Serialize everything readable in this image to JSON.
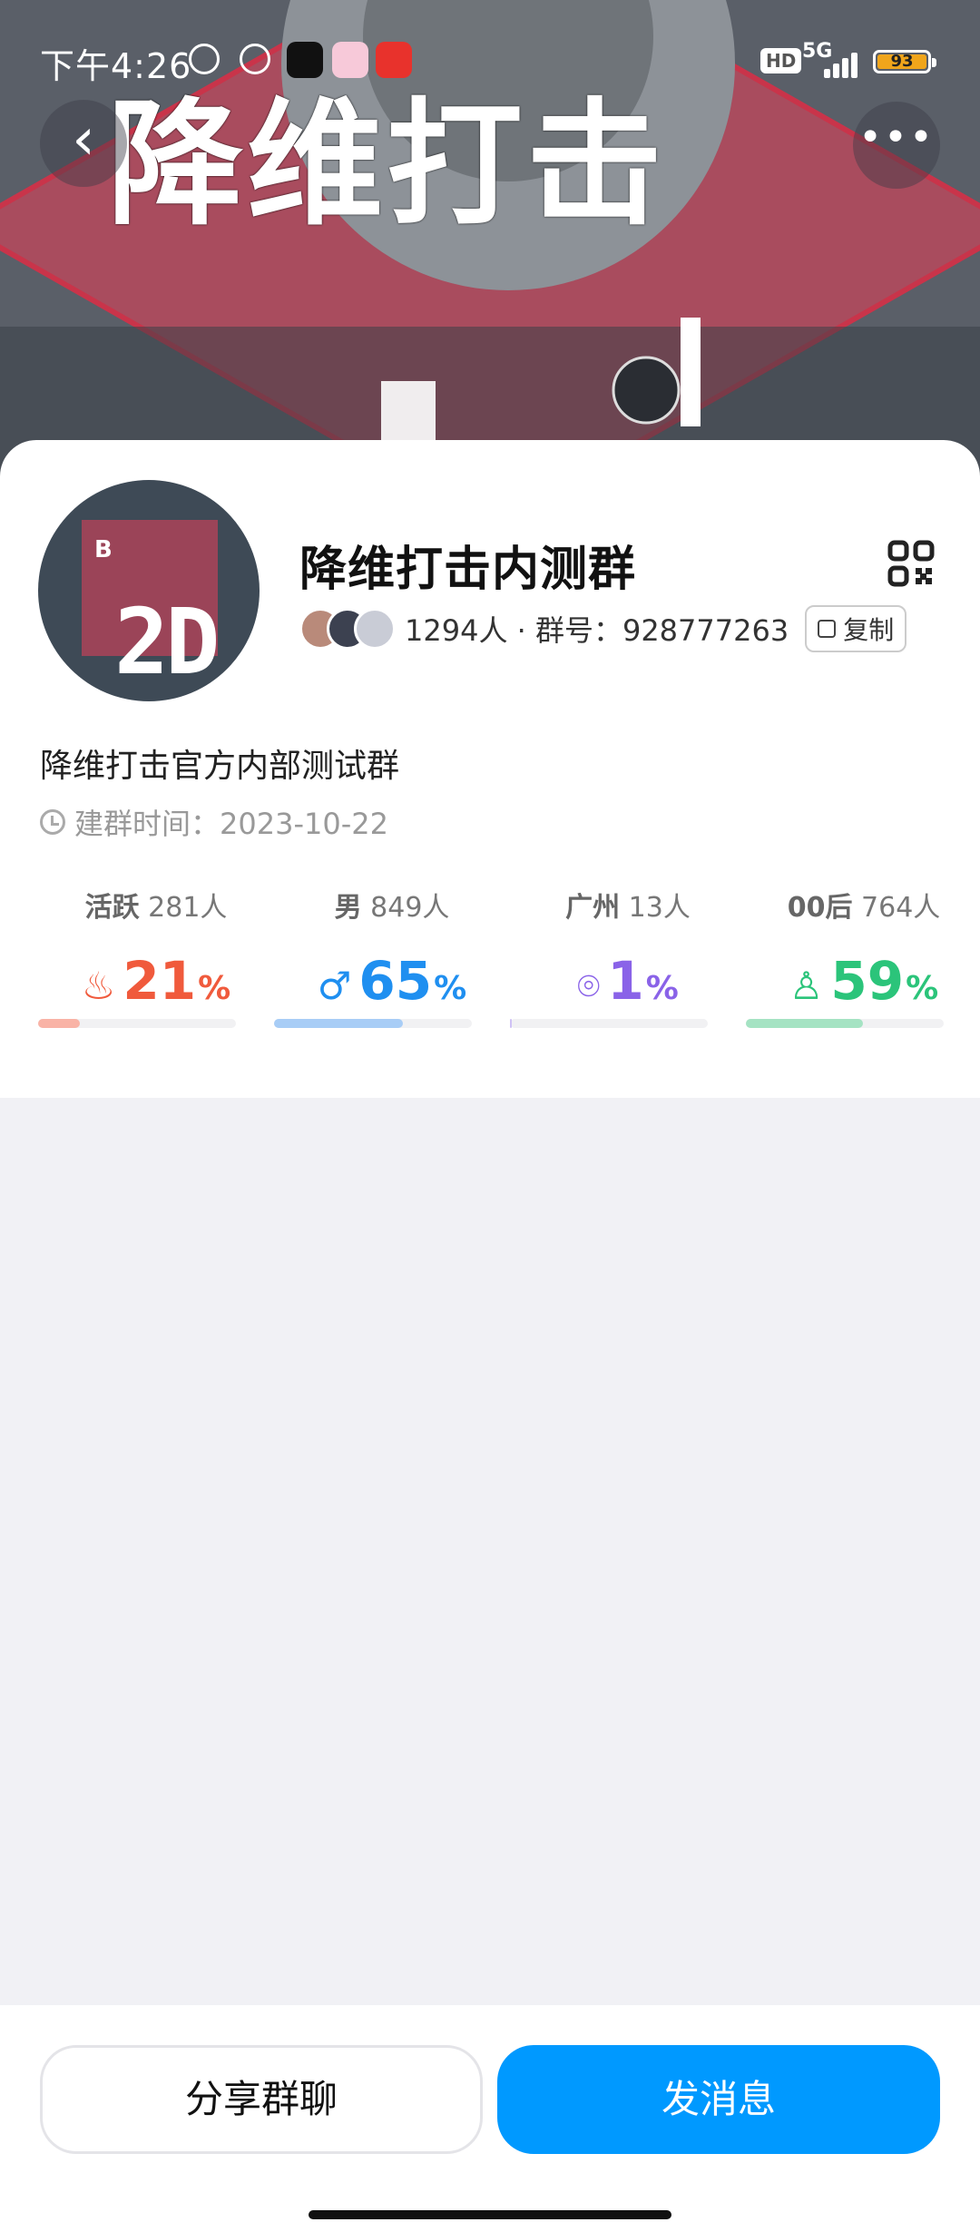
{
  "status_bar": {
    "time": "下午4:26",
    "network": "5G",
    "hd": "HD",
    "battery": "93"
  },
  "header": {
    "banner_title": "降维打击",
    "back_icon": "chevron-left-icon",
    "more_icon": "more-horizontal-icon"
  },
  "group": {
    "avatar_letter": "B",
    "avatar_text": "2D",
    "name": "降维打击内测群",
    "meta": "1294人 · 群号：928777263",
    "copy_label": "复制",
    "description": "降维打击官方内部测试群",
    "created": "建群时间：2023-10-22"
  },
  "stats": [
    {
      "label": "活跃",
      "count": "281人",
      "value": "21",
      "percent_sign": "%",
      "icon": "flame-icon",
      "glyph": "♨",
      "color": "#f05a3c",
      "bar_color": "#f9b3a6",
      "fill": 0.21
    },
    {
      "label": "男",
      "count": "849人",
      "value": "65",
      "percent_sign": "%",
      "icon": "male-icon",
      "glyph": "♂",
      "color": "#1f8ff0",
      "bar_color": "#a8cdf6",
      "fill": 0.65
    },
    {
      "label": "广州",
      "count": "13人",
      "value": "1",
      "percent_sign": "%",
      "icon": "location-pin-icon",
      "glyph": "⌾",
      "color": "#8a63e8",
      "bar_color": "#cfc2f5",
      "fill": 0.01
    },
    {
      "label": "00后",
      "count": "764人",
      "value": "59",
      "percent_sign": "%",
      "icon": "person-icon",
      "glyph": "♙",
      "color": "#2bc47a",
      "bar_color": "#a5e3c3",
      "fill": 0.59
    }
  ],
  "actions": {
    "share_label": "分享群聊",
    "send_label": "发消息"
  }
}
